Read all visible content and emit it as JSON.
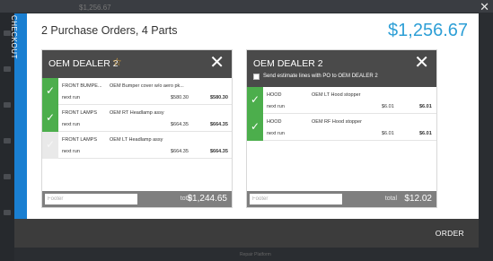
{
  "background": {
    "topbar_text": "$1,256.67",
    "bottom_text": "Repair Platform"
  },
  "modal": {
    "checkout_tab": "CHECKOUT",
    "title": "2 Purchase Orders, 4 Parts",
    "grand_total": "$1,256.67",
    "order_button": "ORDER",
    "colors": {
      "accent": "#1a7fd1",
      "check": "#4cae4c",
      "total": "#2e9fd6"
    }
  },
  "cards": [
    {
      "dealer": "OEM DEALER 2",
      "starred": true,
      "lines": [
        {
          "checked": true,
          "category": "FRONT BUMPE...",
          "description": "OEM Bumper cover w/o aero pk...",
          "run": "next run",
          "list": "$580.30",
          "net": "$580.30"
        },
        {
          "checked": true,
          "category": "FRONT LAMPS",
          "description": "OEM RT Headlamp assy",
          "run": "next run",
          "list": "$664.35",
          "net": "$664.35"
        },
        {
          "checked": false,
          "category": "FRONT LAMPS",
          "description": "OEM LT Headlamp assy",
          "run": "next run",
          "list": "$664.35",
          "net": "$664.35"
        }
      ],
      "footer_placeholder": "Footer",
      "total_label": "total",
      "total": "$1,244.65"
    },
    {
      "dealer": "OEM DEALER 2",
      "send_estimate_label": "Send estimate lines with PO to OEM DEALER 2",
      "lines": [
        {
          "checked": true,
          "category": "HOOD",
          "description": "OEM LT Hood stopper",
          "run": "next run",
          "list": "$6.01",
          "net": "$6.01"
        },
        {
          "checked": true,
          "category": "HOOD",
          "description": "OEM RF Hood stopper",
          "run": "next run",
          "list": "$6.01",
          "net": "$6.01"
        }
      ],
      "footer_placeholder": "Footer",
      "total_label": "total",
      "total": "$12.02"
    }
  ]
}
